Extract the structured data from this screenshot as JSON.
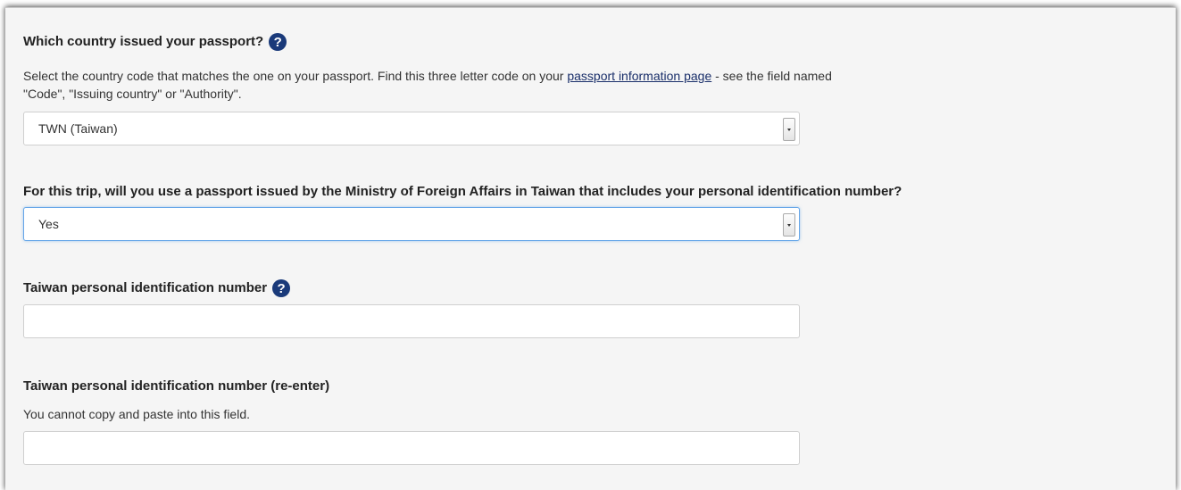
{
  "colors": {
    "help_icon": "#1a3a7a",
    "link": "#1a2f6a",
    "focus_border": "#66a6e8"
  },
  "country": {
    "label": "Which country issued your passport?",
    "help_icon": "question-circle-icon",
    "hint_before": "Select the country code that matches the one on your passport.  Find this three letter code on your ",
    "hint_link": "passport information page",
    "hint_after": " - see the field named",
    "hint_line2": "\"Code\", \"Issuing country\" or \"Authority\".",
    "selected": "TWN (Taiwan)"
  },
  "passport_question": {
    "label": "For this trip, will you use a passport issued by the Ministry of Foreign Affairs in Taiwan that includes your personal identification number?",
    "selected": "Yes"
  },
  "id_number": {
    "label": "Taiwan personal identification number",
    "help_icon": "question-circle-icon",
    "value": "",
    "placeholder": ""
  },
  "id_number_reenter": {
    "label": "Taiwan personal identification number (re-enter)",
    "hint": "You cannot copy and paste into this field.",
    "value": "",
    "placeholder": ""
  }
}
